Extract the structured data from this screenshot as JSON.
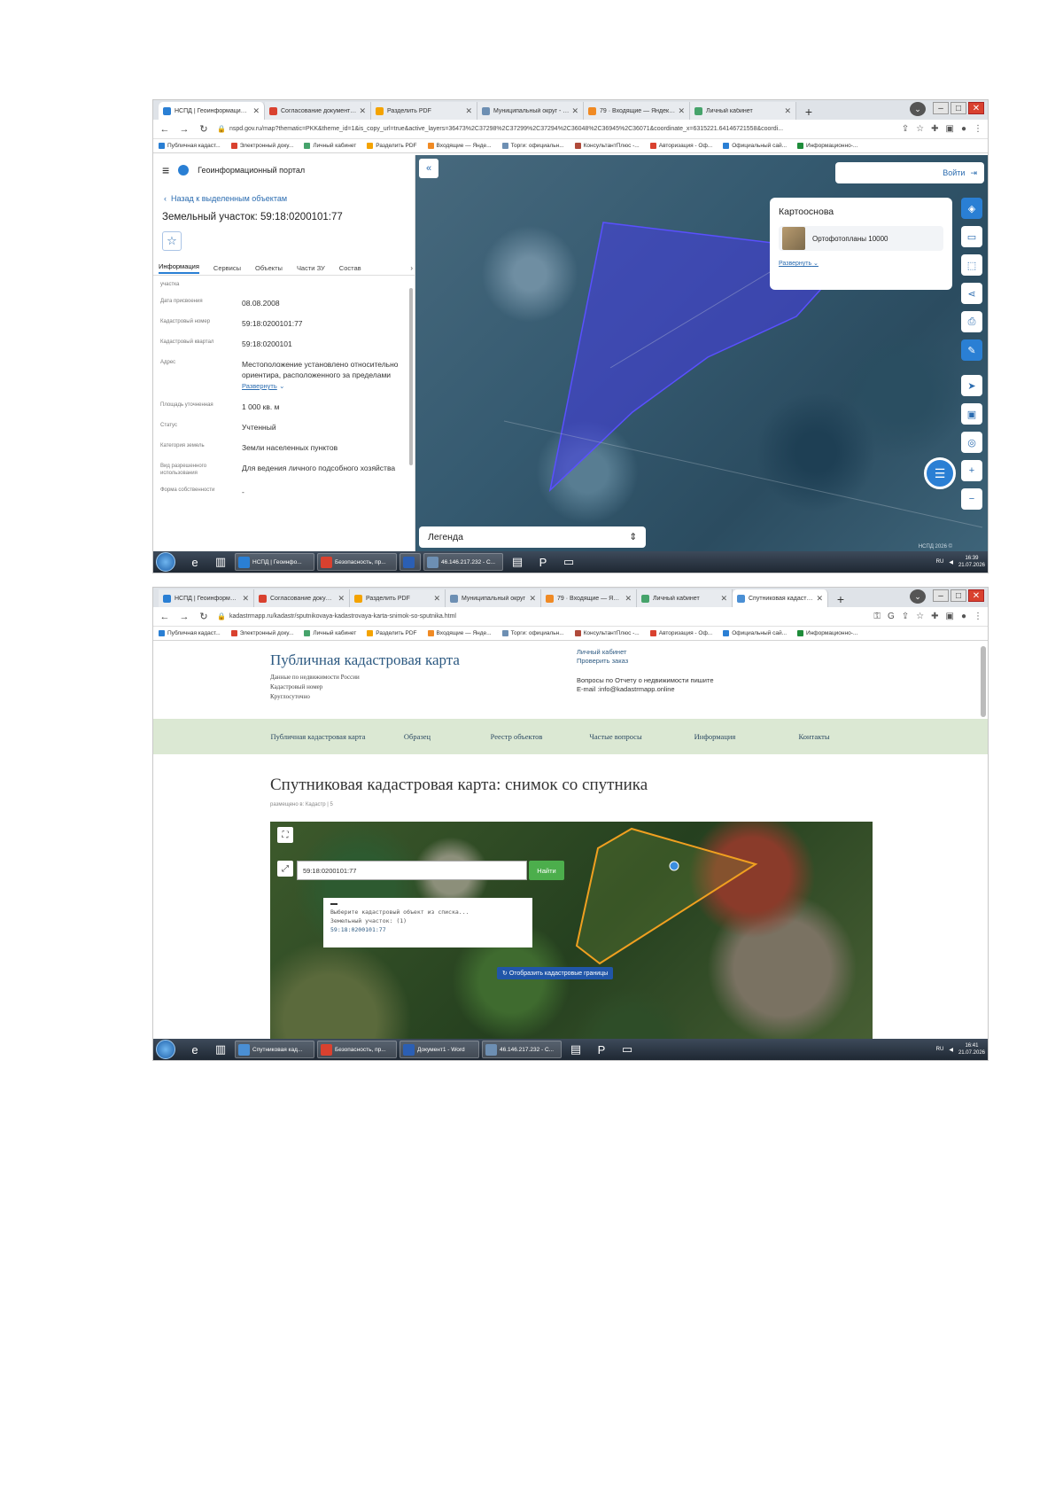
{
  "shot1": {
    "tabs": [
      {
        "label": "НСПД | Геоинформационный",
        "color": "#2a7fd4"
      },
      {
        "label": "Согласование документов : С",
        "color": "#d9412f"
      },
      {
        "label": "Разделить PDF",
        "color": "#f4a300"
      },
      {
        "label": "Муниципальный округ - Ева",
        "color": "#6d8fb3"
      },
      {
        "label": "79 · Входящие — Яндекс Поч",
        "color": "#f08a24"
      },
      {
        "label": "Личный кабинет",
        "color": "#46a36b"
      }
    ],
    "url": "nspd.gov.ru/map?thematic=PKK&theme_id=1&is_copy_url=true&active_layers=36473%2C37298%2C37299%2C37294%2C36048%2C36945%2C36071&coordinate_x=6315221.64146721558&coordi...",
    "bookmarks": [
      {
        "label": "Публичная кадаст...",
        "color": "#2a7fd4"
      },
      {
        "label": "Электронный доку...",
        "color": "#d9412f"
      },
      {
        "label": "Личный кабинет",
        "color": "#46a36b"
      },
      {
        "label": "Разделить PDF",
        "color": "#f4a300"
      },
      {
        "label": "Входящие — Янде...",
        "color": "#f08a24"
      },
      {
        "label": "Торги: официальн...",
        "color": "#6d8fb3"
      },
      {
        "label": "КонсультантПлюс -...",
        "color": "#b04a3a"
      },
      {
        "label": "Авторизация - Оф...",
        "color": "#d9412f"
      },
      {
        "label": "Официальный сай...",
        "color": "#2a7fd4"
      },
      {
        "label": "Информационно-...",
        "color": "#1e8c3a"
      }
    ],
    "portal_title": "Геоинформационный портал",
    "back_link": "Назад к выделенным объектам",
    "object_title": "Земельный участок: 59:18:0200101:77",
    "info_tabs": [
      "Информация",
      "Сервисы",
      "Объекты",
      "Части ЗУ",
      "Состав"
    ],
    "props": [
      {
        "key": "участка",
        "value": ""
      },
      {
        "key": "Дата присвоения",
        "value": "08.08.2008"
      },
      {
        "key": "Кадастровый номер",
        "value": "59:18:0200101:77"
      },
      {
        "key": "Кадастровый квартал",
        "value": "59:18:0200101"
      },
      {
        "key": "Адрес",
        "value": "Местоположение установлено относительно ориентира, расположенного за пределами",
        "link": "Развернуть"
      },
      {
        "key": "Площадь уточненная",
        "value": "1 000 кв. м"
      },
      {
        "key": "Статус",
        "value": "Учтенный"
      },
      {
        "key": "Категория земель",
        "value": "Земли населенных пунктов"
      },
      {
        "key": "Вид разрешенного использования",
        "value": "Для ведения личного подсобного хозяйства"
      },
      {
        "key": "Форма собственности",
        "value": "-"
      }
    ],
    "login": "Войти",
    "basemap_title": "Картооснова",
    "basemap_item": "Ортофотопланы 10000",
    "basemap_expand": "Развернуть",
    "legend": "Легенда",
    "copyright": "НСПД 2026 ©",
    "taskbar": [
      {
        "label": "НСПД | Геоинфо...",
        "color": "#2a7fd4"
      },
      {
        "label": "Безопасность, пр...",
        "color": "#d9412f"
      },
      {
        "label": "",
        "color": "#2b5fb4"
      },
      {
        "label": "46.146.217.232 - С...",
        "color": "#6d8fb3"
      }
    ],
    "lang": "RU",
    "time": "16:39",
    "date": "21.07.2026"
  },
  "shot2": {
    "tabs": [
      {
        "label": "НСПД | Геоинформацио",
        "color": "#2a7fd4"
      },
      {
        "label": "Согласование докумен",
        "color": "#d9412f"
      },
      {
        "label": "Разделить PDF",
        "color": "#f4a300"
      },
      {
        "label": "Муниципальный округ",
        "color": "#6d8fb3"
      },
      {
        "label": "79 · Входящие — Яндек",
        "color": "#f08a24"
      },
      {
        "label": "Личный кабинет",
        "color": "#46a36b"
      },
      {
        "label": "Спутниковая кадастрол",
        "color": "#4a8fd4"
      }
    ],
    "url": "kadastrmapp.ru/kadastr/sputnikovaya-kadastrovaya-karta-snimok-so-sputnika.html",
    "site_title": "Публичная кадастровая карта",
    "site_sub": [
      "Данные по недвижимости России",
      "Кадастровый номер",
      "Круглосуточно"
    ],
    "header_links": [
      "Личный кабинет",
      "Проверить заказ"
    ],
    "contact_text": "Вопросы по Отчету о недвижимости пишите",
    "contact_email": "E-mail :info@kadastrmapp.online",
    "nav": [
      "Публичная кадастровая карта",
      "Образец",
      "Реестр объектов",
      "Частые вопросы",
      "Информация",
      "Контакты"
    ],
    "heading": "Спутниковая кадастровая карта: снимок со спутника",
    "meta": "размещено в: Кадастр | 5",
    "search_value": "59:18:0200101:77",
    "find_button": "Найти",
    "dropdown": [
      "Выберите кадастровый объект из списка...",
      "Земельный участок: (1)",
      "59:18:0200101:77"
    ],
    "show_borders": "Отобразить кадастровые границы",
    "taskbar": [
      {
        "label": "Спутниковая кад...",
        "color": "#4a8fd4"
      },
      {
        "label": "Безопасность, пр...",
        "color": "#d9412f"
      },
      {
        "label": "Документ1 - Word",
        "color": "#2b5fb4"
      },
      {
        "label": "46.146.217.232 - С...",
        "color": "#6d8fb3"
      }
    ],
    "lang": "RU",
    "time": "16:41",
    "date": "21.07.2026"
  }
}
